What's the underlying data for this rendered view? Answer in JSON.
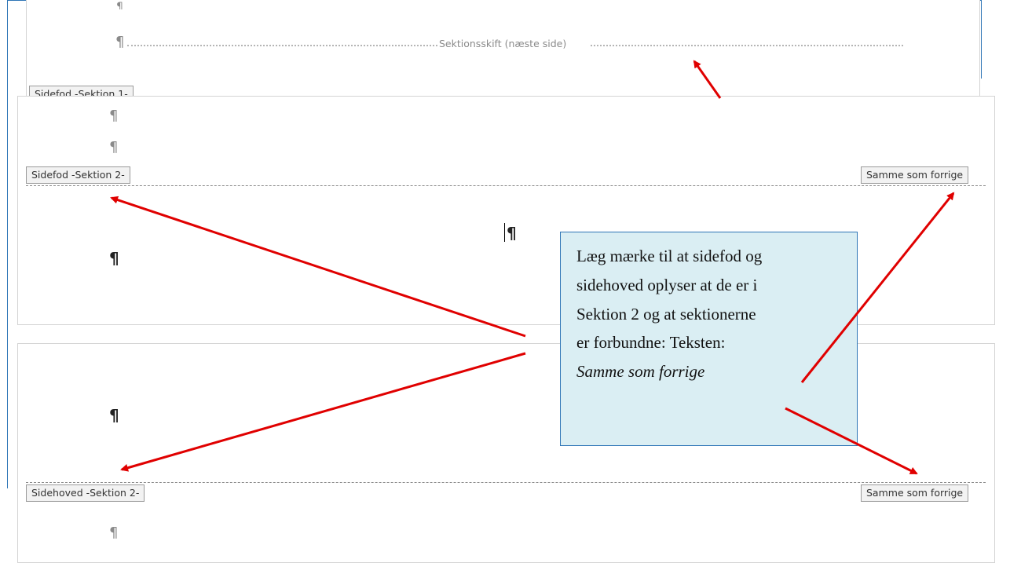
{
  "document": {
    "section_break_label": "Sektionsskift (næste side)",
    "footer_section1_tag": "Sidefod -Sektion 1-",
    "footer_section2_tag": "Sidefod -Sektion 2-",
    "header_section2_tag": "Sidehoved -Sektion 2-",
    "same_as_previous_footer": "Samme som forrige",
    "same_as_previous_header": "Samme som forrige",
    "pilcrow": "¶"
  },
  "callout": {
    "lines": [
      "Læg mærke til at sidefod og",
      "sidehoved oplyser at de er i",
      "Sektion 2 og at sektionerne",
      "er forbundne: Teksten:"
    ],
    "emphasis": "Samme som forrige"
  },
  "colors": {
    "arrow": "#e00000",
    "callout_fill": "#daeef3",
    "callout_border": "#2e75b6",
    "frame_border": "#2e75b6"
  }
}
